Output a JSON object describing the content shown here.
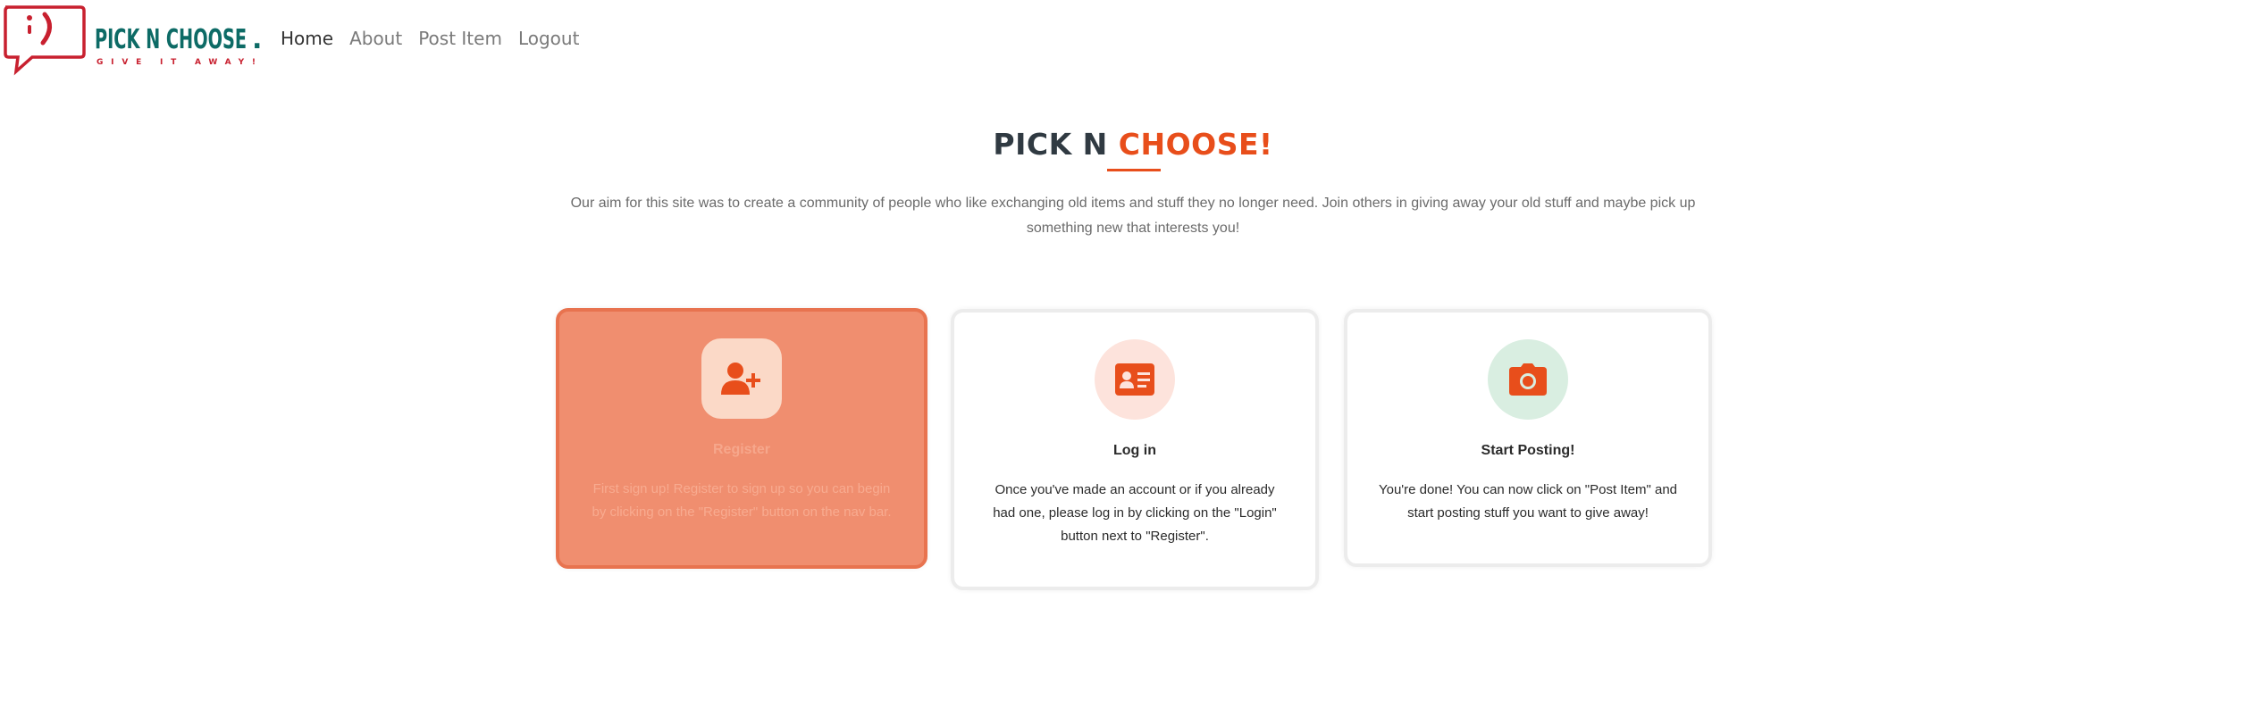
{
  "brand": {
    "name": "PICK N CHOOSE",
    "dot": ".",
    "tagline": "GIVE IT AWAY!",
    "colors": {
      "primary": "#0d6b66",
      "accent": "#c8202f"
    }
  },
  "nav": {
    "items": [
      {
        "label": "Home",
        "active": true
      },
      {
        "label": "About",
        "active": false
      },
      {
        "label": "Post Item",
        "active": false
      },
      {
        "label": "Logout",
        "active": false
      }
    ]
  },
  "hero": {
    "title_main": "PICK N ",
    "title_accent": "CHOOSE!",
    "description": "Our aim for this site was to create a community of people who like exchanging old items and stuff they no longer need. Join others in giving away your old stuff and maybe pick up something new that interests you!"
  },
  "cards": [
    {
      "icon": "user-plus-icon",
      "title": "Register",
      "text": "First sign up! Register to sign up so you can begin by clicking on the \"Register\" button on the nav bar."
    },
    {
      "icon": "id-card-icon",
      "title": "Log in",
      "text": "Once you've made an account or if you already had one, please log in by clicking on the \"Login\" button next to \"Register\"."
    },
    {
      "icon": "camera-icon",
      "title": "Start Posting!",
      "text": "You're done! You can now click on \"Post Item\" and start posting stuff you want to give away!"
    }
  ],
  "colors": {
    "accent": "#e84e1b",
    "card_highlight_bg": "#f08e6f",
    "text_dark": "#303a42"
  }
}
